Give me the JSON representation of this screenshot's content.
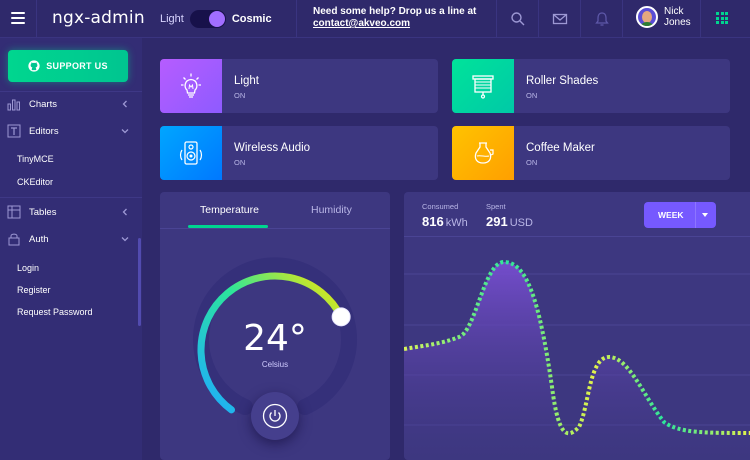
{
  "header": {
    "brand": "ngx-admin",
    "theme_light": "Light",
    "theme_cosmic": "Cosmic",
    "help_text": "Need some help? Drop us a line at",
    "help_email": "contact@akveo.com",
    "user_first": "Nick",
    "user_last": "Jones",
    "icons": [
      "menu-icon",
      "search-icon",
      "mail-icon",
      "bell-icon",
      "apps-grid-icon"
    ]
  },
  "sidebar": {
    "support_label": "SUPPORT US",
    "items": [
      {
        "label": "Charts",
        "icon": "chart-icon"
      },
      {
        "label": "Editors",
        "icon": "editor-icon"
      },
      {
        "label": "Tables",
        "icon": "table-icon"
      },
      {
        "label": "Auth",
        "icon": "lock-icon"
      }
    ],
    "editors_sub": [
      "TinyMCE",
      "CKEditor"
    ],
    "auth_sub": [
      "Login",
      "Register",
      "Request Password"
    ]
  },
  "devices": [
    {
      "title": "Light",
      "status": "ON",
      "icon": "light-bulb-icon",
      "color": "#9f5bff"
    },
    {
      "title": "Roller Shades",
      "status": "ON",
      "icon": "roller-shades-icon",
      "color": "#00d68f"
    },
    {
      "title": "Wireless Audio",
      "status": "ON",
      "icon": "speaker-icon",
      "color": "#0095ff"
    },
    {
      "title": "Coffee Maker",
      "status": "ON",
      "icon": "coffee-maker-icon",
      "color": "#ffaa00"
    }
  ],
  "temperature": {
    "tab_temperature": "Temperature",
    "tab_humidity": "Humidity",
    "value": "24°",
    "unit": "Celsius",
    "level_fraction": 0.72
  },
  "electricity": {
    "consumed_label": "Consumed",
    "consumed_value": "816",
    "consumed_unit": "kWh",
    "spent_label": "Spent",
    "spent_value": "291",
    "spent_unit": "USD",
    "period": "WEEK"
  },
  "colors": {
    "background": "#2f296b",
    "card": "#3d3780",
    "accent_green": "#00d68f",
    "accent_purple": "#7659ff"
  }
}
